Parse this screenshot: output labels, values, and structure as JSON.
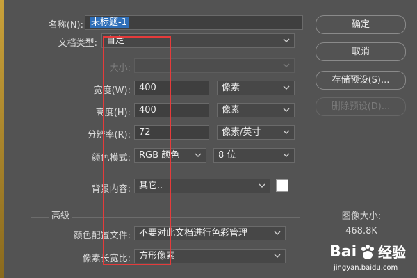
{
  "form": {
    "name": {
      "label": "名称(N):",
      "value": "未标题-1"
    },
    "doc_type": {
      "label": "文档类型:",
      "value": "自定"
    },
    "size": {
      "label": "大小:",
      "value": ""
    },
    "width": {
      "label": "宽度(W):",
      "value": "400",
      "unit": "像素"
    },
    "height": {
      "label": "高度(H):",
      "value": "400",
      "unit": "像素"
    },
    "resolution": {
      "label": "分辨率(R):",
      "value": "72",
      "unit": "像素/英寸"
    },
    "color_mode": {
      "label": "颜色模式:",
      "value": "RGB 颜色",
      "bits": "8 位"
    },
    "background": {
      "label": "背景内容:",
      "value": "其它..",
      "swatch_color": "#ffffff"
    }
  },
  "advanced": {
    "title": "高级",
    "color_profile": {
      "label": "颜色配置文件:",
      "value": "不要对此文档进行色彩管理"
    },
    "pixel_aspect": {
      "label": "像素长宽比:",
      "value": "方形像素"
    }
  },
  "buttons": {
    "ok": "确定",
    "cancel": "取消",
    "save_preset": "存储预设(S)...",
    "delete_preset": "删除预设(D)..."
  },
  "image_size": {
    "label": "图像大小:",
    "value": "468.8K"
  },
  "watermark": {
    "brand": "Bai",
    "brand2": "经验",
    "url": "jingyan.baidu.com"
  },
  "colors": {
    "highlight": "#2f6fb9",
    "annotation": "#e53b3b",
    "panel": "#535353"
  }
}
